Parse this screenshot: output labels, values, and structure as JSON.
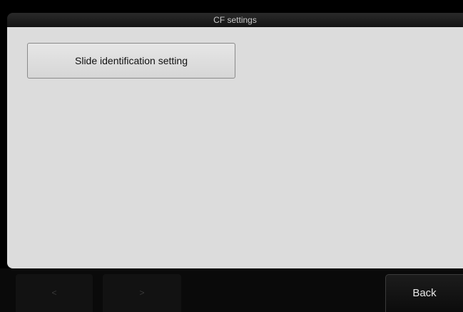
{
  "window": {
    "title": "CF settings"
  },
  "main": {
    "buttons": [
      {
        "label": "Slide identification setting"
      }
    ]
  },
  "footer": {
    "prev_label": "<",
    "next_label": ">",
    "back_label": "Back"
  }
}
